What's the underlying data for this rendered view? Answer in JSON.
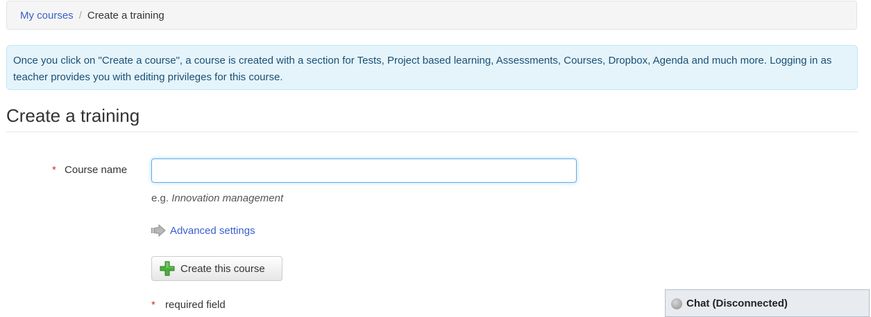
{
  "breadcrumb": {
    "home": "My courses",
    "separator": "/",
    "current": "Create a training"
  },
  "info_message": "Once you click on \"Create a course\", a course is created with a section for Tests, Project based learning, Assessments, Courses, Dropbox, Agenda and much more. Logging in as teacher provides you with editing privileges for this course.",
  "heading": "Create a training",
  "form": {
    "required_marker": "*",
    "course_name_label": "Course name",
    "course_name_value": "",
    "help_prefix": "e.g.",
    "help_example": "Innovation management",
    "advanced_settings": "Advanced settings",
    "submit_label": "Create this course",
    "required_note": "required field"
  },
  "chat": {
    "label": "Chat (Disconnected)",
    "status": "disconnected"
  },
  "colors": {
    "link": "#3a5fcd",
    "info_bg": "#e5f4fb",
    "required": "#c0392b",
    "plus_icon": "#4cae3c"
  }
}
